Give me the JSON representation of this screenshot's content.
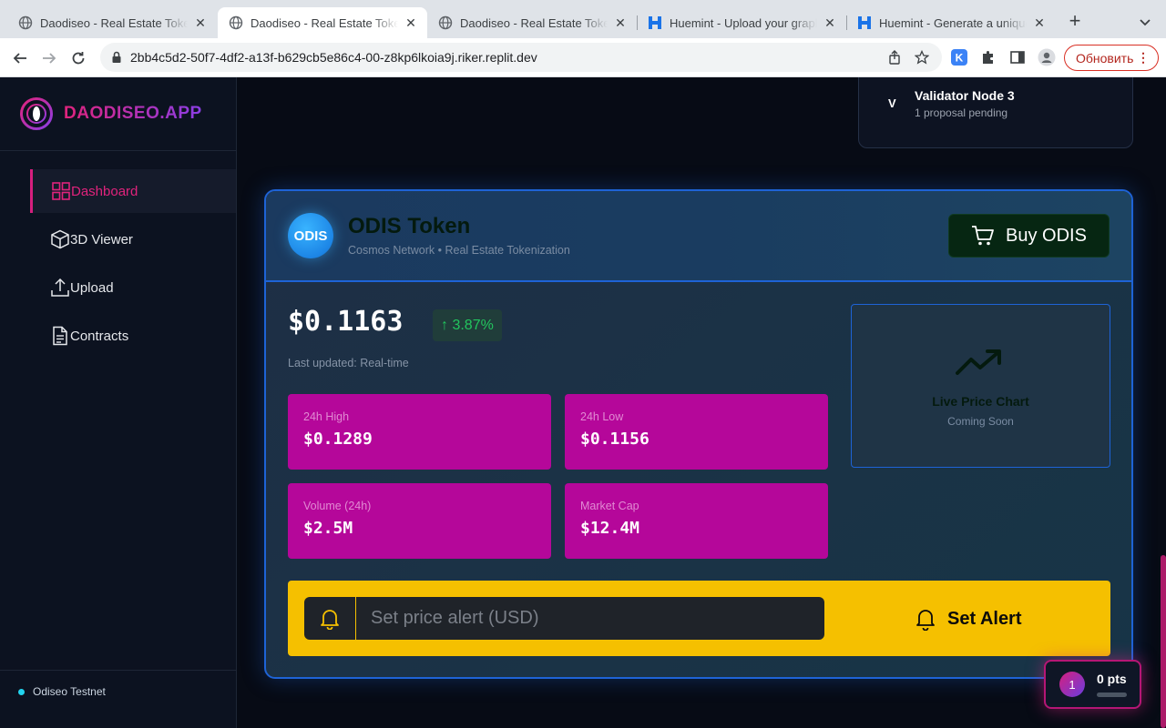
{
  "browser": {
    "tabs": [
      {
        "title": "Daodiseo - Real Estate Tokenization",
        "icon": "globe-icon",
        "active": false
      },
      {
        "title": "Daodiseo - Real Estate Tokenization",
        "icon": "globe-icon",
        "active": true
      },
      {
        "title": "Daodiseo - Real Estate Tokenization",
        "icon": "globe-icon",
        "active": false
      },
      {
        "title": "Huemint - Upload your graphic",
        "icon": "huemint-icon",
        "active": false
      },
      {
        "title": "Huemint - Generate a unique color palette",
        "icon": "huemint-icon",
        "active": false
      }
    ],
    "url": "2bb4c5d2-50f7-4df2-a13f-b629cb5e86c4-00-z8kp6lkoia9j.riker.replit.dev",
    "update_button": "Обновить"
  },
  "sidebar": {
    "brand": "DAODISEO.APP",
    "nav": [
      {
        "label": "Dashboard",
        "icon": "dashboard-grid-icon",
        "active": true
      },
      {
        "label": "3D Viewer",
        "icon": "cube-icon",
        "active": false
      },
      {
        "label": "Upload",
        "icon": "upload-icon",
        "active": false
      },
      {
        "label": "Contracts",
        "icon": "document-icon",
        "active": false
      }
    ],
    "network": "Odiseo Testnet"
  },
  "validator": {
    "letter": "V",
    "name": "Validator Node 3",
    "status": "1 proposal pending"
  },
  "token": {
    "logo_text": "ODIS",
    "name": "ODIS Token",
    "subtitle": "Cosmos Network • Real Estate Tokenization",
    "buy_label": "Buy ODIS",
    "price": "$0.1163",
    "change": "↑ 3.87%",
    "updated": "Last updated: Real-time",
    "stats": [
      {
        "label": "24h High",
        "value": "$0.1289"
      },
      {
        "label": "24h Low",
        "value": "$0.1156"
      },
      {
        "label": "Volume (24h)",
        "value": "$2.5M"
      },
      {
        "label": "Market Cap",
        "value": "$12.4M"
      }
    ],
    "chart": {
      "title": "Live Price Chart",
      "subtitle": "Coming Soon"
    },
    "alert": {
      "placeholder": "Set price alert (USD)",
      "value": "",
      "button": "Set Alert"
    }
  },
  "points": {
    "level": "1",
    "label": "0 pts",
    "progress": 0
  },
  "colors": {
    "accent": "#d61f7e",
    "stat_card": "#b5079a",
    "alert_bar": "#f5c000",
    "border_blue": "#1e63d6",
    "positive": "#22c55e"
  }
}
